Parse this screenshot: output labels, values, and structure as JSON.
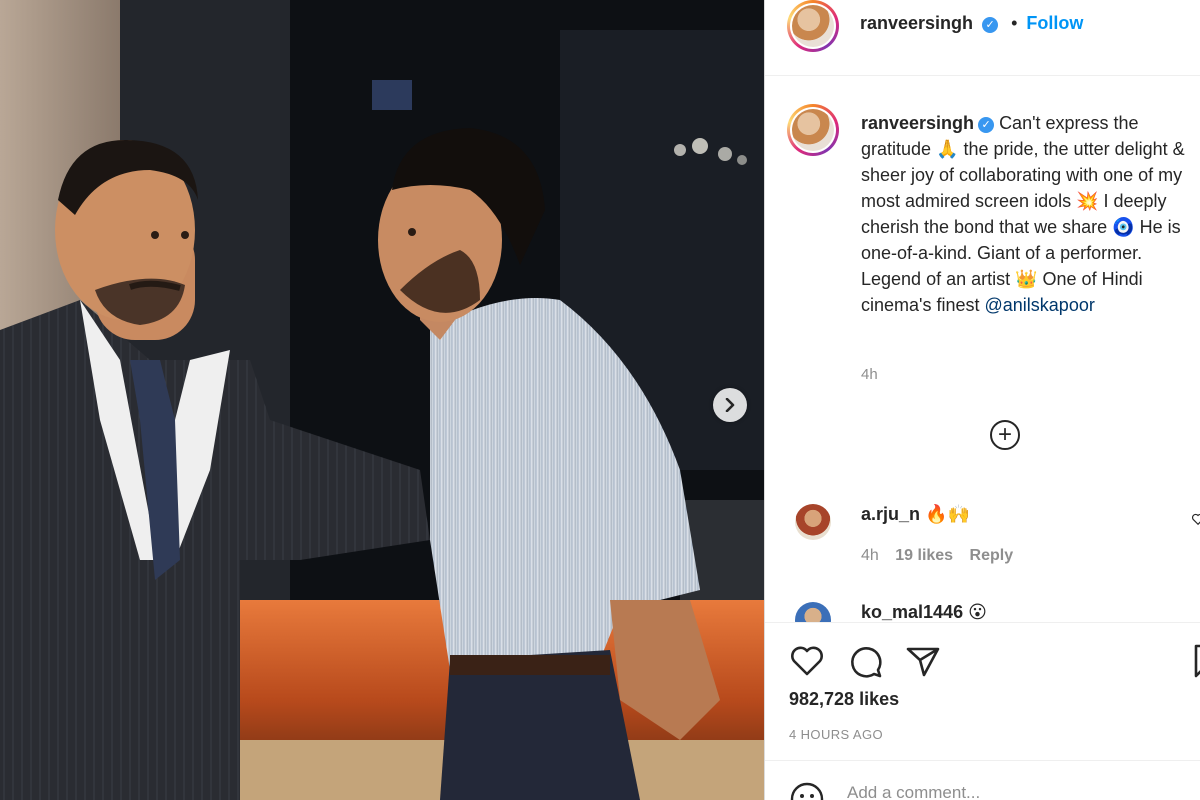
{
  "post_header": {
    "username": "ranveersingh",
    "verified_mark": "✓",
    "separator": "•",
    "follow_label": "Follow"
  },
  "caption": {
    "username": "ranveersingh",
    "text_1": "Can't express the gratitude ",
    "emoji_1": "🙏",
    "text_2": " the pride, the utter delight & sheer joy of collaborating with one of my most admired screen idols ",
    "emoji_2": "💥",
    "text_3": " I deeply cherish the bond that we share ",
    "emoji_3": "🧿",
    "text_4": " He is one-of-a-kind. Giant of a performer. Legend of an artist ",
    "emoji_4": "👑",
    "text_5": " One of Hindi cinema's finest ",
    "mention": "@anilskapoor",
    "time": "4h"
  },
  "load_more_label": "+",
  "comments": [
    {
      "username": "a.rju_n",
      "text": "🔥🙌",
      "time": "4h",
      "likes": "19 likes",
      "reply": "Reply"
    },
    {
      "username": "ko_mal1446",
      "text": "😮"
    }
  ],
  "actions": {
    "likes": "982,728 likes",
    "posted_ago": "4 HOURS AGO",
    "add_comment_placeholder": "Add a comment..."
  },
  "icons": {
    "like": "heart-icon",
    "comment": "comment-icon",
    "share": "paper-plane-icon",
    "save": "bookmark-icon",
    "next": "chevron-right-icon",
    "emoji": "smiley-icon"
  },
  "colors": {
    "link_blue": "#0095f6",
    "verified_blue": "#3897f0",
    "mention_blue": "#00376b",
    "muted_grey": "#8e8e8e"
  }
}
